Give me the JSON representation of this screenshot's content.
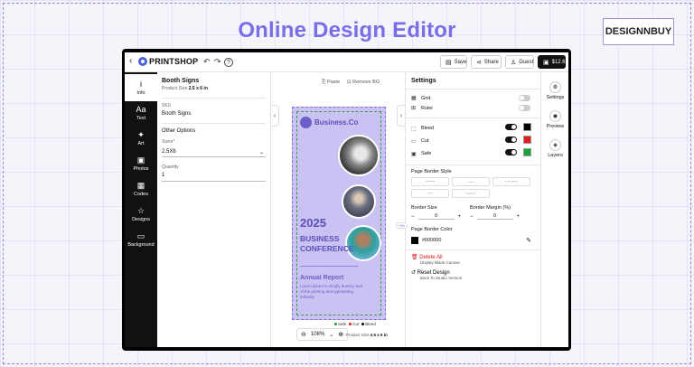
{
  "hero": {
    "title": "Online Design Editor",
    "brand": "DESIGNNBUY"
  },
  "topbar": {
    "back_icon": "‹",
    "logo_text": "PRINTSHOP",
    "undo_icon": "↶",
    "redo_icon": "↷",
    "help_icon": "?",
    "save_label": "Save",
    "share_label": "Share",
    "guest_label": "Guest",
    "price_label": "$12.6"
  },
  "rail": {
    "items": [
      {
        "label": "Info",
        "icon": "i"
      },
      {
        "label": "Text",
        "icon": "Aa"
      },
      {
        "label": "Art",
        "icon": "✦"
      },
      {
        "label": "Photos",
        "icon": "▣"
      },
      {
        "label": "Codes",
        "icon": "▦"
      },
      {
        "label": "Designs",
        "icon": "☆"
      },
      {
        "label": "Background",
        "icon": "▭"
      }
    ]
  },
  "info": {
    "title": "Booth Signs",
    "product_size_label": "Product Size",
    "product_size_value": "2.5 x 6 in",
    "sku_label": "SKU",
    "sku_value": "Booth Signs",
    "other_options": "Other Options",
    "sizes_label": "Sizes*",
    "sizes_value": "2.5X6",
    "quantity_label": "Quantity",
    "quantity_value": "1"
  },
  "canvas": {
    "paste_label": "Paste",
    "remove_bg_label": "Remove BG",
    "sign": {
      "brand": "Business.Co",
      "year": "2025",
      "headline": "BUSINESS CONFERENCE",
      "report": "Annual Report",
      "lorem": "Lorem ipsum is simply dummy text of the printing and typesetting industry."
    },
    "legend": {
      "safe": "Safe",
      "cut": "Cut",
      "bleed": "Bleed"
    },
    "zoom_value": "108%",
    "zoom_out_icon": "⊖",
    "zoom_in_icon": "⊕",
    "size_label": "Product Size",
    "size_value": "2.5 x 6 in",
    "ai_badge": "+Ai"
  },
  "settings": {
    "title": "Settings",
    "grid_label": "Grid",
    "ruler_label": "Ruler",
    "bleed_label": "Bleed",
    "cut_label": "Cut",
    "safe_label": "Safe",
    "colors": {
      "bleed": "#000000",
      "cut": "#e01b1b",
      "safe": "#17a33a"
    },
    "page_border_style": "Page Border Style",
    "border_styles": [
      "------",
      "......",
      "-.--.--.-",
      "-.-",
      "-..-..-",
      ""
    ],
    "border_size_label": "Border Size",
    "border_size_value": "0",
    "border_margin_label": "Border Margin (%)",
    "border_margin_value": "0",
    "page_border_color": "Page Border Color",
    "color_value": "#000000",
    "delete_all": "Delete All",
    "delete_all_sub": "Display Blank Canvas",
    "reset_design": "Reset Design",
    "reset_design_sub": "Back To Studio Version"
  },
  "right_rail": {
    "settings": "Settings",
    "preview": "Preview",
    "layers": "Layers"
  }
}
